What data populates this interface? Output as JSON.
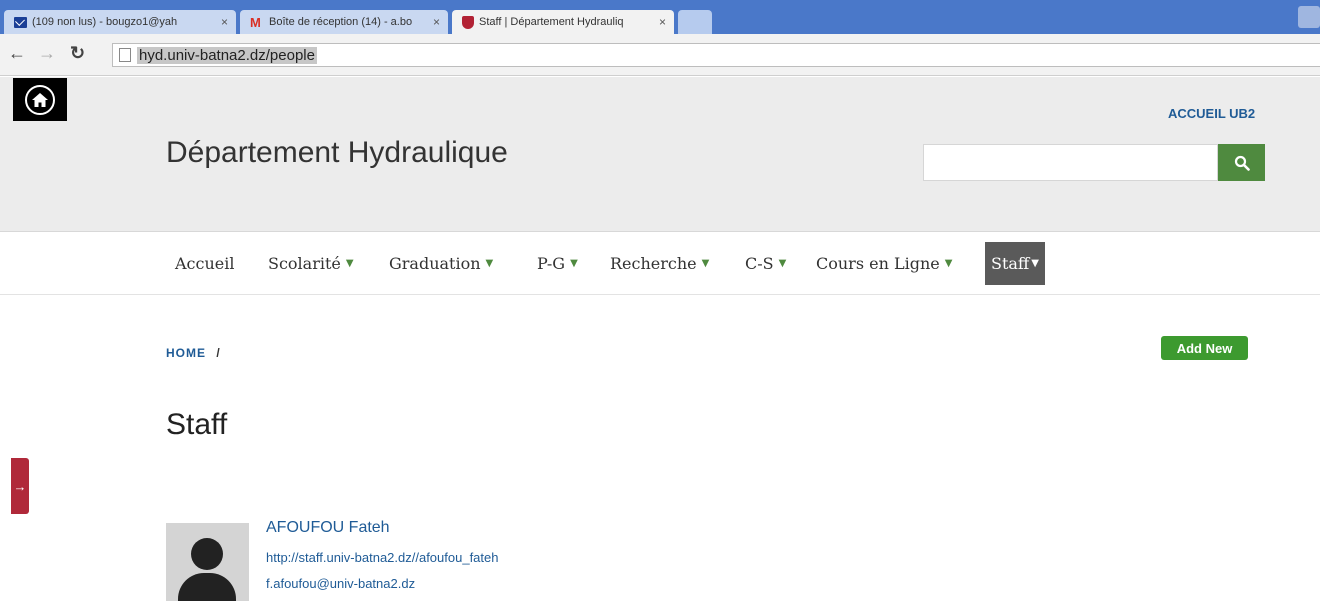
{
  "browser": {
    "tabs": [
      {
        "title": "(109 non lus) - bougzo1@yah",
        "icon": "mail-icon",
        "active": false
      },
      {
        "title": "Boîte de réception (14) - a.bo",
        "icon": "gmail-icon",
        "active": false
      },
      {
        "title": "Staff | Département Hydrauliq",
        "icon": "shield-icon",
        "active": true
      }
    ],
    "tab_close": "×",
    "url": "hyd.univ-batna2.dz/people"
  },
  "header": {
    "site_title": "Département Hydraulique",
    "top_link": "ACCUEIL UB2",
    "search": {
      "value": "",
      "placeholder": ""
    }
  },
  "nav": {
    "items": [
      {
        "label": "Accueil",
        "has_dropdown": false
      },
      {
        "label": "Scolarité",
        "has_dropdown": true
      },
      {
        "label": "Graduation",
        "has_dropdown": true
      },
      {
        "label": "P-G",
        "has_dropdown": true
      },
      {
        "label": "Recherche",
        "has_dropdown": true
      },
      {
        "label": "C-S",
        "has_dropdown": true
      },
      {
        "label": "Cours en Ligne",
        "has_dropdown": true
      },
      {
        "label": "Staff",
        "has_dropdown": true,
        "active": true
      }
    ],
    "dropdown_glyph": "▼"
  },
  "breadcrumb": {
    "home": "HOME",
    "separator": "/"
  },
  "actions": {
    "add_new": "Add New"
  },
  "page": {
    "title": "Staff"
  },
  "staff": [
    {
      "name": "AFOUFOU Fateh",
      "url": "http://staff.univ-batna2.dz//afoufou_fateh",
      "email": "f.afoufou@univ-batna2.dz"
    }
  ],
  "colors": {
    "accent_green": "#4f8a3f",
    "add_new_green": "#3d9a2f",
    "link_blue": "#1f5b96",
    "header_bg": "#ececec",
    "active_nav_bg": "#5a5a5a",
    "side_tab_red": "#b0293a"
  }
}
